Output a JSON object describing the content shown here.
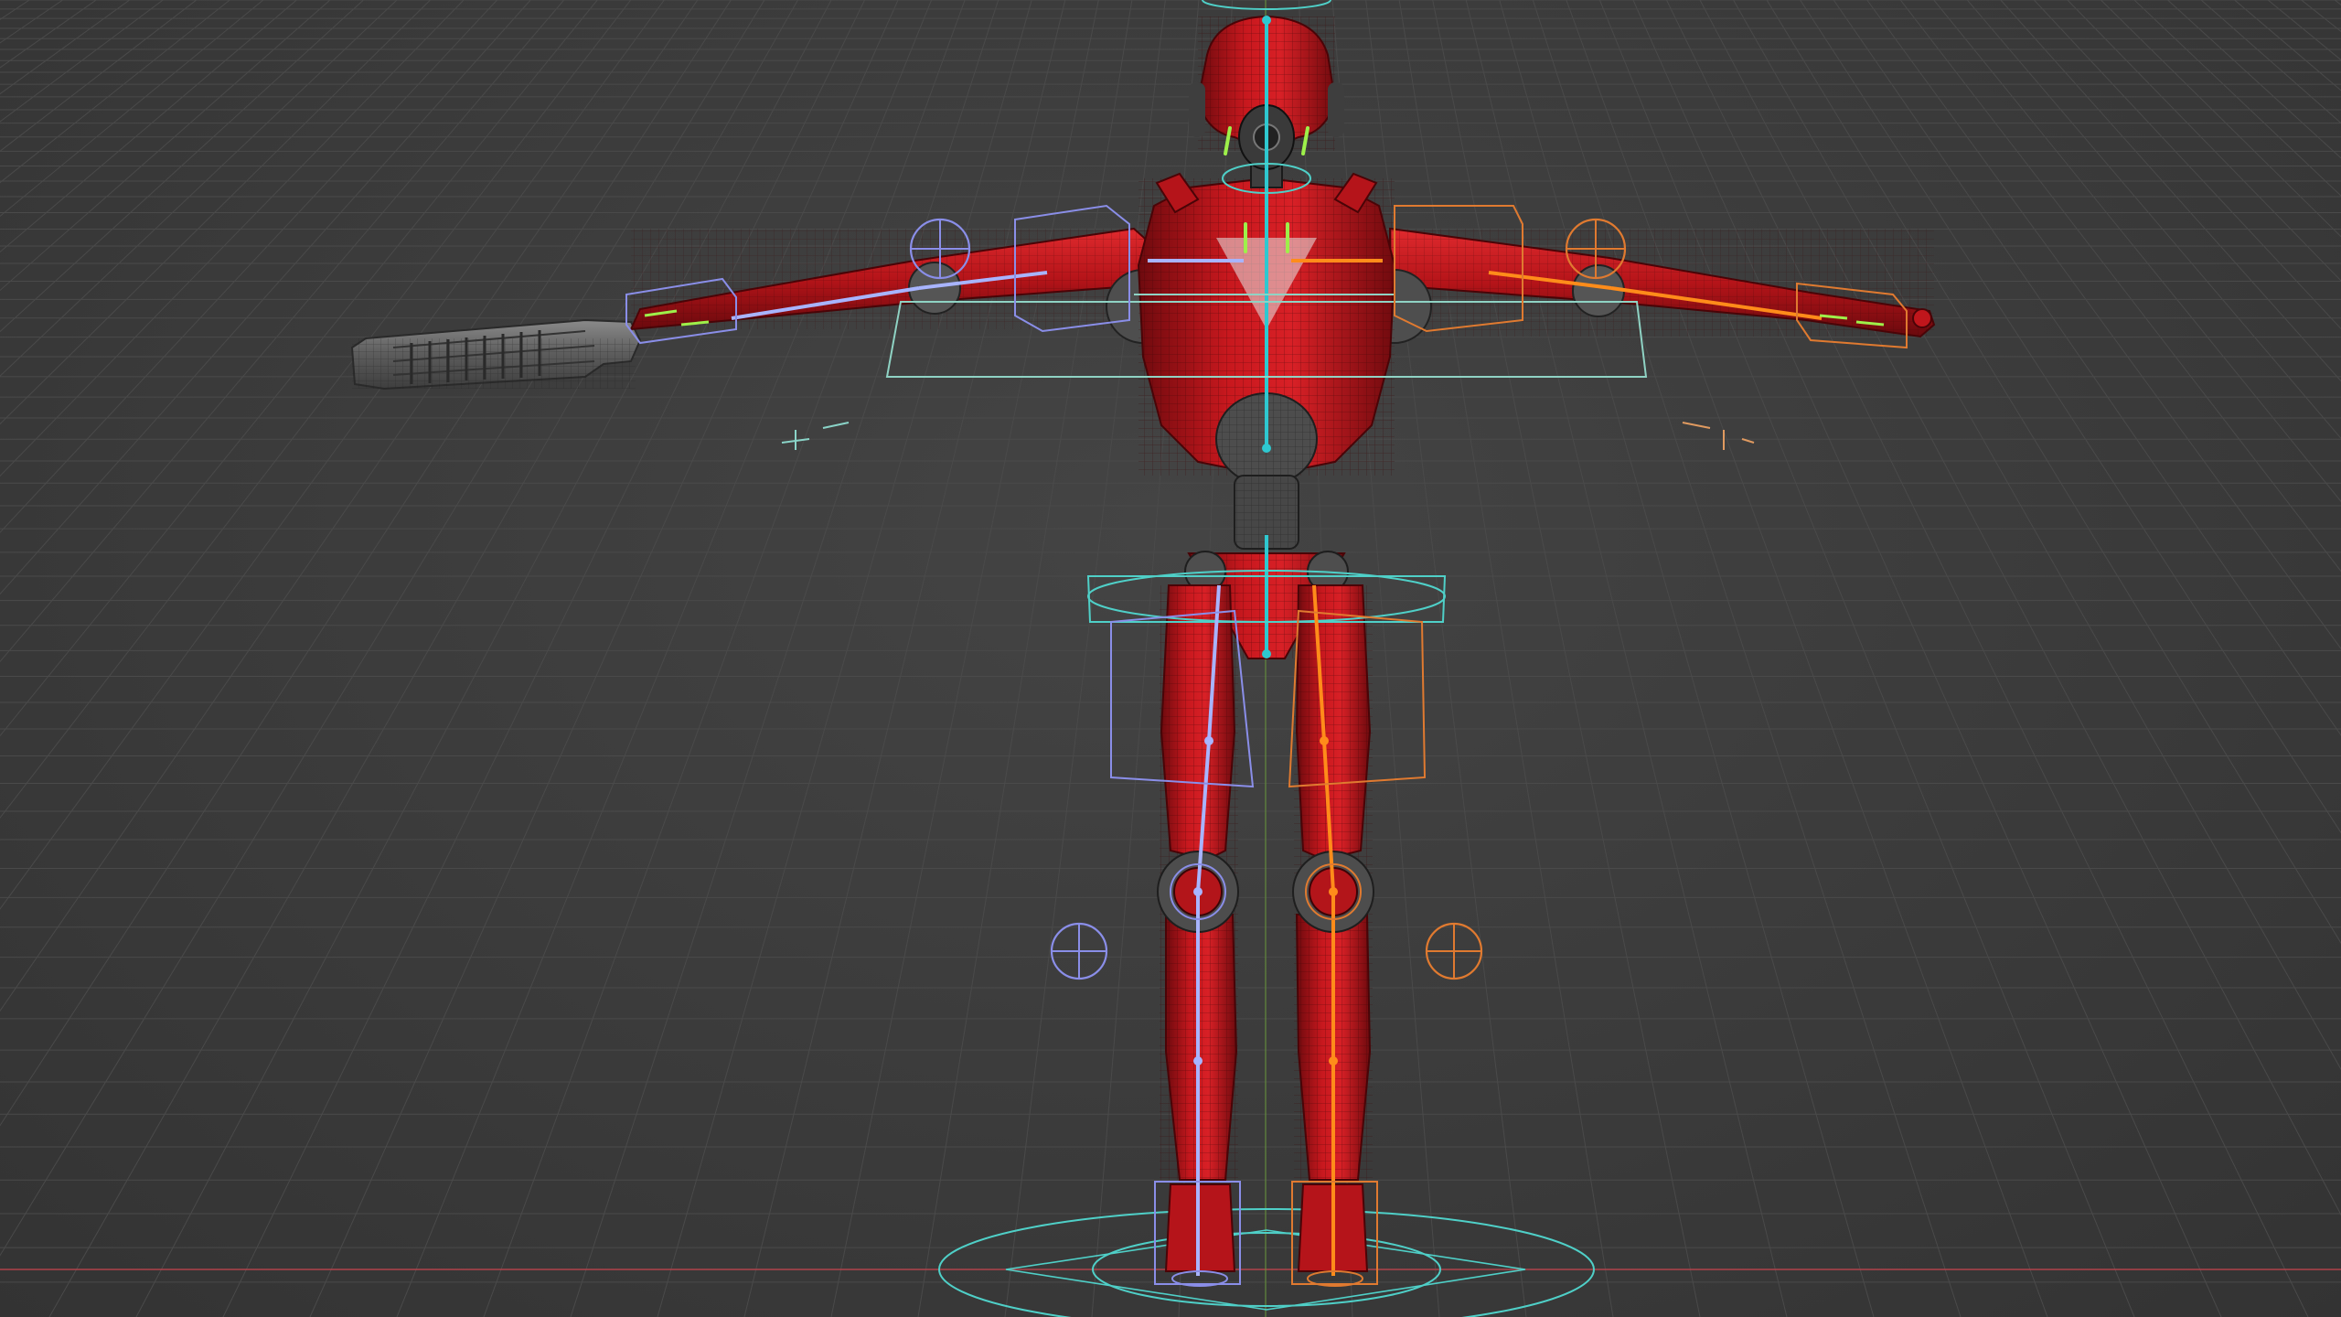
{
  "viewport": {
    "colors": {
      "background": "#3d3d3d",
      "grid_line": "#4a4a4a",
      "x_axis": "#b0424a",
      "y_axis": "#6a9a3a",
      "mesh_red": "#c0161c",
      "mesh_red_dark": "#7a0c10",
      "mesh_grey": "#555555",
      "bone_left": "#a8b4ff",
      "bone_right": "#ff8c1a",
      "bone_center": "#2ec8d0",
      "ctrl_cyan": "#4fd0c8",
      "ctrl_blue": "#8a8ee8",
      "ctrl_orange": "#e07a30",
      "weapon_grey": "#6b6b6b"
    },
    "objects": [
      {
        "name": "robot-mesh",
        "icon": "mesh"
      },
      {
        "name": "armature",
        "icon": "armature"
      },
      {
        "name": "rifle-mesh",
        "icon": "mesh"
      },
      {
        "name": "root-control",
        "icon": "circle-control"
      }
    ]
  }
}
